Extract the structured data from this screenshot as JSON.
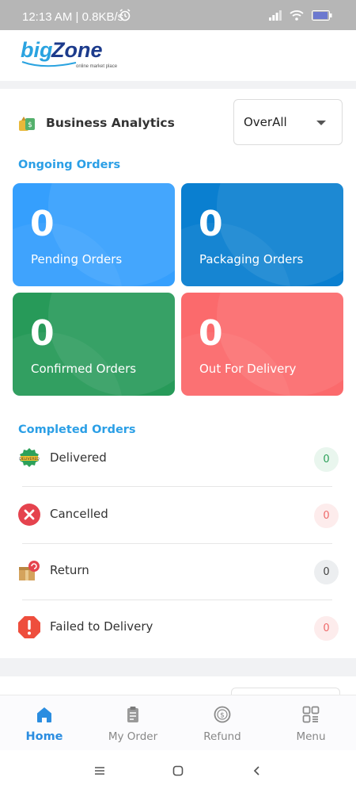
{
  "status_bar": {
    "time_speed": "12:13 AM | 0.8KB/s"
  },
  "header": {
    "logo_big": "big",
    "logo_zone": "Zone",
    "logo_tagline": "online market place"
  },
  "analytics": {
    "title": "Business Analytics",
    "filter_value": "OverAll"
  },
  "ongoing": {
    "title": "Ongoing Orders",
    "cards": [
      {
        "count": "0",
        "label": "Pending Orders",
        "color": "#359ffd"
      },
      {
        "count": "0",
        "label": "Packaging Orders",
        "color": "#0a7fd0"
      },
      {
        "count": "0",
        "label": "Confirmed Orders",
        "color": "#279a59"
      },
      {
        "count": "0",
        "label": "Out For Delivery",
        "color": "#fb6a6c"
      }
    ]
  },
  "completed": {
    "title": "Completed Orders",
    "items": [
      {
        "label": "Delivered",
        "count": "0"
      },
      {
        "label": "Cancelled",
        "count": "0"
      },
      {
        "label": "Return",
        "count": "0"
      },
      {
        "label": "Failed to Delivery",
        "count": "0"
      }
    ]
  },
  "bottom_nav": [
    {
      "label": "Home",
      "active": true
    },
    {
      "label": "My Order"
    },
    {
      "label": "Refund"
    },
    {
      "label": "Menu"
    }
  ]
}
